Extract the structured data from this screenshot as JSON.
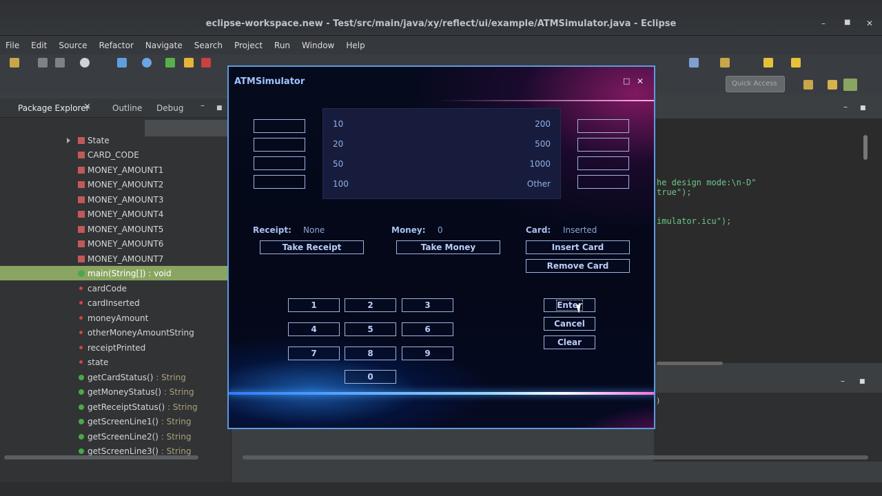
{
  "window": {
    "title": "eclipse-workspace.new - Test/src/main/java/xy/reflect/ui/example/ATMSimulator.java - Eclipse"
  },
  "menu": [
    "File",
    "Edit",
    "Source",
    "Refactor",
    "Navigate",
    "Search",
    "Project",
    "Run",
    "Window",
    "Help"
  ],
  "quick_access": "Quick Access",
  "left_panel": {
    "tabs": [
      "Package Explorer",
      "Outline",
      "Debug"
    ],
    "items": [
      {
        "label": "State",
        "ret": ""
      },
      {
        "label": "CARD_CODE",
        "ret": ""
      },
      {
        "label": "MONEY_AMOUNT1",
        "ret": ""
      },
      {
        "label": "MONEY_AMOUNT2",
        "ret": ""
      },
      {
        "label": "MONEY_AMOUNT3",
        "ret": ""
      },
      {
        "label": "MONEY_AMOUNT4",
        "ret": ""
      },
      {
        "label": "MONEY_AMOUNT5",
        "ret": ""
      },
      {
        "label": "MONEY_AMOUNT6",
        "ret": ""
      },
      {
        "label": "MONEY_AMOUNT7",
        "ret": ""
      },
      {
        "label": "main(String[]) : void",
        "ret": ""
      },
      {
        "label": "cardCode",
        "ret": ""
      },
      {
        "label": "cardInserted",
        "ret": ""
      },
      {
        "label": "moneyAmount",
        "ret": ""
      },
      {
        "label": "otherMoneyAmountString",
        "ret": ""
      },
      {
        "label": "receiptPrinted",
        "ret": ""
      },
      {
        "label": "state",
        "ret": ""
      },
      {
        "label": "getCardStatus()",
        "ret": " : String"
      },
      {
        "label": "getMoneyStatus()",
        "ret": " : String"
      },
      {
        "label": "getReceiptStatus()",
        "ret": " : String"
      },
      {
        "label": "getScreenLine1()",
        "ret": " : String"
      },
      {
        "label": "getScreenLine2()",
        "ret": " : String"
      },
      {
        "label": "getScreenLine3()",
        "ret": " : String"
      }
    ]
  },
  "editor_lines": [
    "he design mode:\\n-D\"",
    "true\");",
    "imulator.icu\");"
  ],
  "console_line": ")",
  "atm": {
    "title": "ATMSimulator",
    "screen": {
      "left": [
        "10",
        "20",
        "50",
        "100"
      ],
      "right": [
        "200",
        "500",
        "1000",
        "Other"
      ]
    },
    "receipt_label": "Receipt:",
    "receipt_value": "None",
    "money_label": "Money:",
    "money_value": "0",
    "card_label": "Card:",
    "card_value": "Inserted",
    "take_receipt": "Take Receipt",
    "take_money": "Take Money",
    "insert_card": "Insert Card",
    "remove_card": "Remove Card",
    "keys": [
      "1",
      "2",
      "3",
      "4",
      "5",
      "6",
      "7",
      "8",
      "9",
      "0"
    ],
    "enter": "Enter",
    "cancel": "Cancel",
    "clear": "Clear"
  }
}
